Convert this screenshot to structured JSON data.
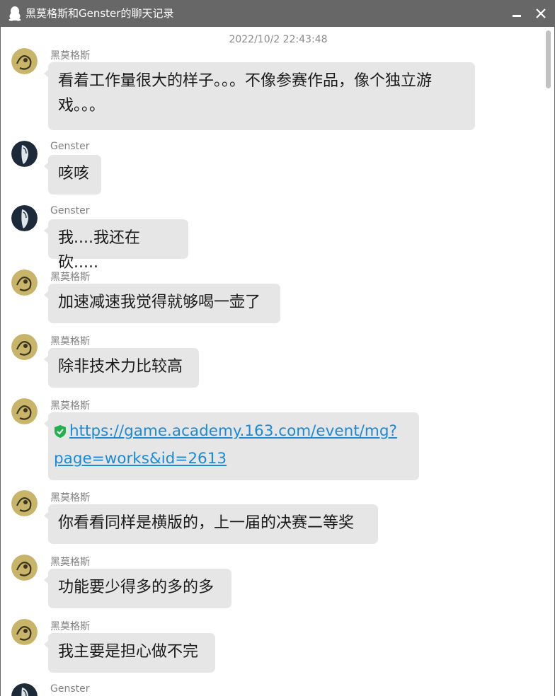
{
  "window": {
    "title": "黑莫格斯和Genster的聊天记录",
    "title_icon": "qq-penguin-icon",
    "bg_color": "#676767"
  },
  "chat": {
    "timestamp": "2022/10/2 22:43:48",
    "messages": [
      {
        "sender": "黑莫格斯",
        "text": "看着工作量很大的样子。。。不像参赛作品，像个独立游戏。。。",
        "avatar": "avatar-hmgs"
      },
      {
        "sender": "Genster",
        "text": "咳咳",
        "avatar": "avatar-genster"
      },
      {
        "sender": "Genster",
        "text": "我....我还在砍.....",
        "avatar": "avatar-genster"
      },
      {
        "sender": "黑莫格斯",
        "text": "加速减速我觉得就够喝一壶了",
        "avatar": "avatar-hmgs"
      },
      {
        "sender": "黑莫格斯",
        "text": "除非技术力比较高",
        "avatar": "avatar-hmgs"
      },
      {
        "sender": "黑莫格斯",
        "link_line1": "https://game.academy.163.com/event/mg?",
        "link_line2": "page=works&id=2613",
        "avatar": "avatar-hmgs"
      },
      {
        "sender": "黑莫格斯",
        "text": "你看看同样是横版的，上一届的决赛二等奖",
        "avatar": "avatar-hmgs"
      },
      {
        "sender": "黑莫格斯",
        "text": "功能要少得多的多的多",
        "avatar": "avatar-hmgs"
      },
      {
        "sender": "黑莫格斯",
        "text": "我主要是担心做不完",
        "avatar": "avatar-hmgs"
      },
      {
        "sender": "Genster",
        "avatar": "avatar-genster"
      }
    ]
  },
  "colors": {
    "bubble": "#e6e6e6",
    "link": "#1a8ad8",
    "timestamp": "#8a8a8a",
    "sender": "#808080"
  }
}
